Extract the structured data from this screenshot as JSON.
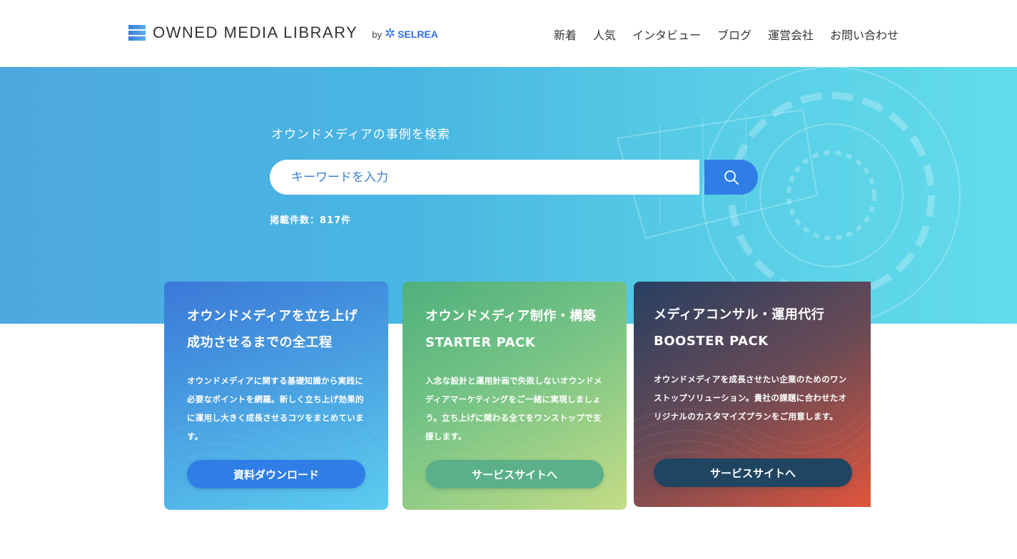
{
  "header": {
    "logo_text": "OWNED MEDIA LIBRARY",
    "by_label": "by",
    "brand": "SELREA",
    "nav": [
      "新着",
      "人気",
      "インタビュー",
      "ブログ",
      "運営会社",
      "お問い合わせ"
    ]
  },
  "hero": {
    "title": "オウンドメディアの事例を検索",
    "search_placeholder": "キーワードを入力",
    "count_text": "掲載件数：817件"
  },
  "cards": [
    {
      "title_line1": "オウンドメディアを立ち上げ",
      "title_line2": "成功させるまでの全工程",
      "description": "オウンドメディアに関する基礎知識から実践に必要なポイントを網羅。新しく立ち上げ効果的に運用し大きく成長させるコツをまとめています。",
      "button": "資料ダウンロード"
    },
    {
      "title_line1": "オウンドメディア制作・構築",
      "title_line2": "STARTER PACK",
      "description": "入念な設計と運用計画で失敗しないオウンドメディアマーケティングをご一緒に実現しましょう。立ち上げに関わる全てをワンストップで支援します。",
      "button": "サービスサイトへ"
    },
    {
      "title_line1": "メディアコンサル・運用代行",
      "title_line2": "BOOSTER PACK",
      "description": "オウンドメディアを成長させたい企業のためのワンストップソリューション。貴社の課題に合わせたオリジナルのカスタマイズプランをご用意します。",
      "button": "サービスサイトへ"
    }
  ],
  "colors": {
    "accent": "#2f7ee6",
    "hero_start": "#4fa8e0",
    "hero_end": "#62dceb"
  }
}
